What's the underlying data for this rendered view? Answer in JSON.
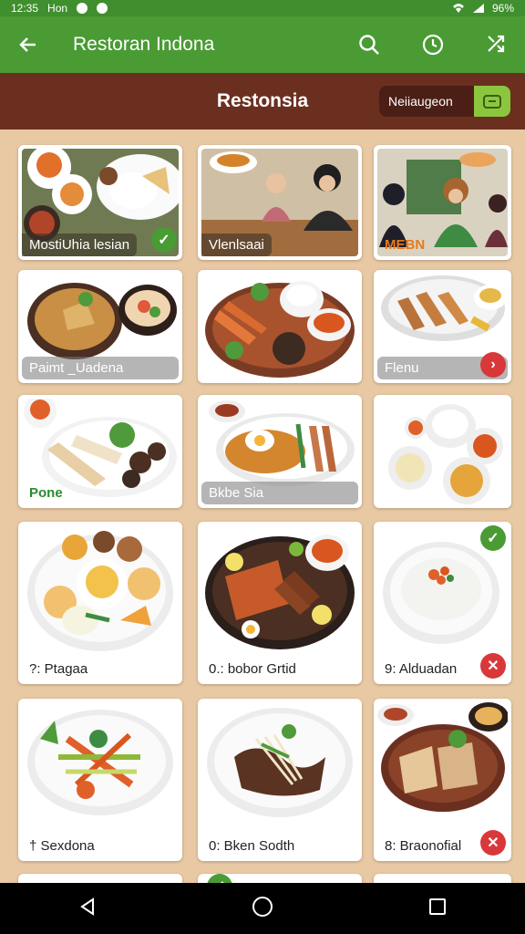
{
  "status_bar": {
    "time": "12:35",
    "carrier": "Hon",
    "battery": "96%"
  },
  "app_bar": {
    "title": "Restoran Indona",
    "icons": [
      "back-arrow-icon",
      "search-icon",
      "clock-icon",
      "shuffle-icon"
    ]
  },
  "sub_bar": {
    "brand": "Restonsia",
    "pill_label": "Neiiaugeon"
  },
  "cards": [
    {
      "label": "MostiUhia lesian",
      "style": "dark",
      "badge": "check"
    },
    {
      "label": "Vlenlsaai",
      "style": "dark",
      "badge": ""
    },
    {
      "label": "MEBN",
      "style": "orange",
      "badge": ""
    },
    {
      "label": "Paimt _Uadena",
      "style": "grey",
      "badge": ""
    },
    {
      "label": "",
      "style": "plain",
      "badge": ""
    },
    {
      "label": "Flenu",
      "style": "grey",
      "badge": "arrow"
    },
    {
      "label": "Pone",
      "style": "green",
      "badge": ""
    },
    {
      "label": "Bkbe Sia",
      "style": "grey",
      "badge": ""
    },
    {
      "label": "",
      "style": "plain",
      "badge": ""
    },
    {
      "label": "?: Ptagaa",
      "style": "plain",
      "badge": ""
    },
    {
      "label": "0.: bobor Grtid",
      "style": "plain",
      "badge": ""
    },
    {
      "label": "9: Alduadan",
      "style": "plain",
      "badge": "close",
      "badge_top": "check"
    },
    {
      "label": "† Sexdona",
      "style": "plain",
      "badge": ""
    },
    {
      "label": "0: Bken Sodth",
      "style": "plain",
      "badge": ""
    },
    {
      "label": "8: Braonofial",
      "style": "plain",
      "badge": "close"
    }
  ],
  "colors": {
    "app_bar": "#4a9b34",
    "sub_bar": "#6b2f20",
    "background": "#e9c9a3",
    "accent_red": "#d9383a"
  }
}
